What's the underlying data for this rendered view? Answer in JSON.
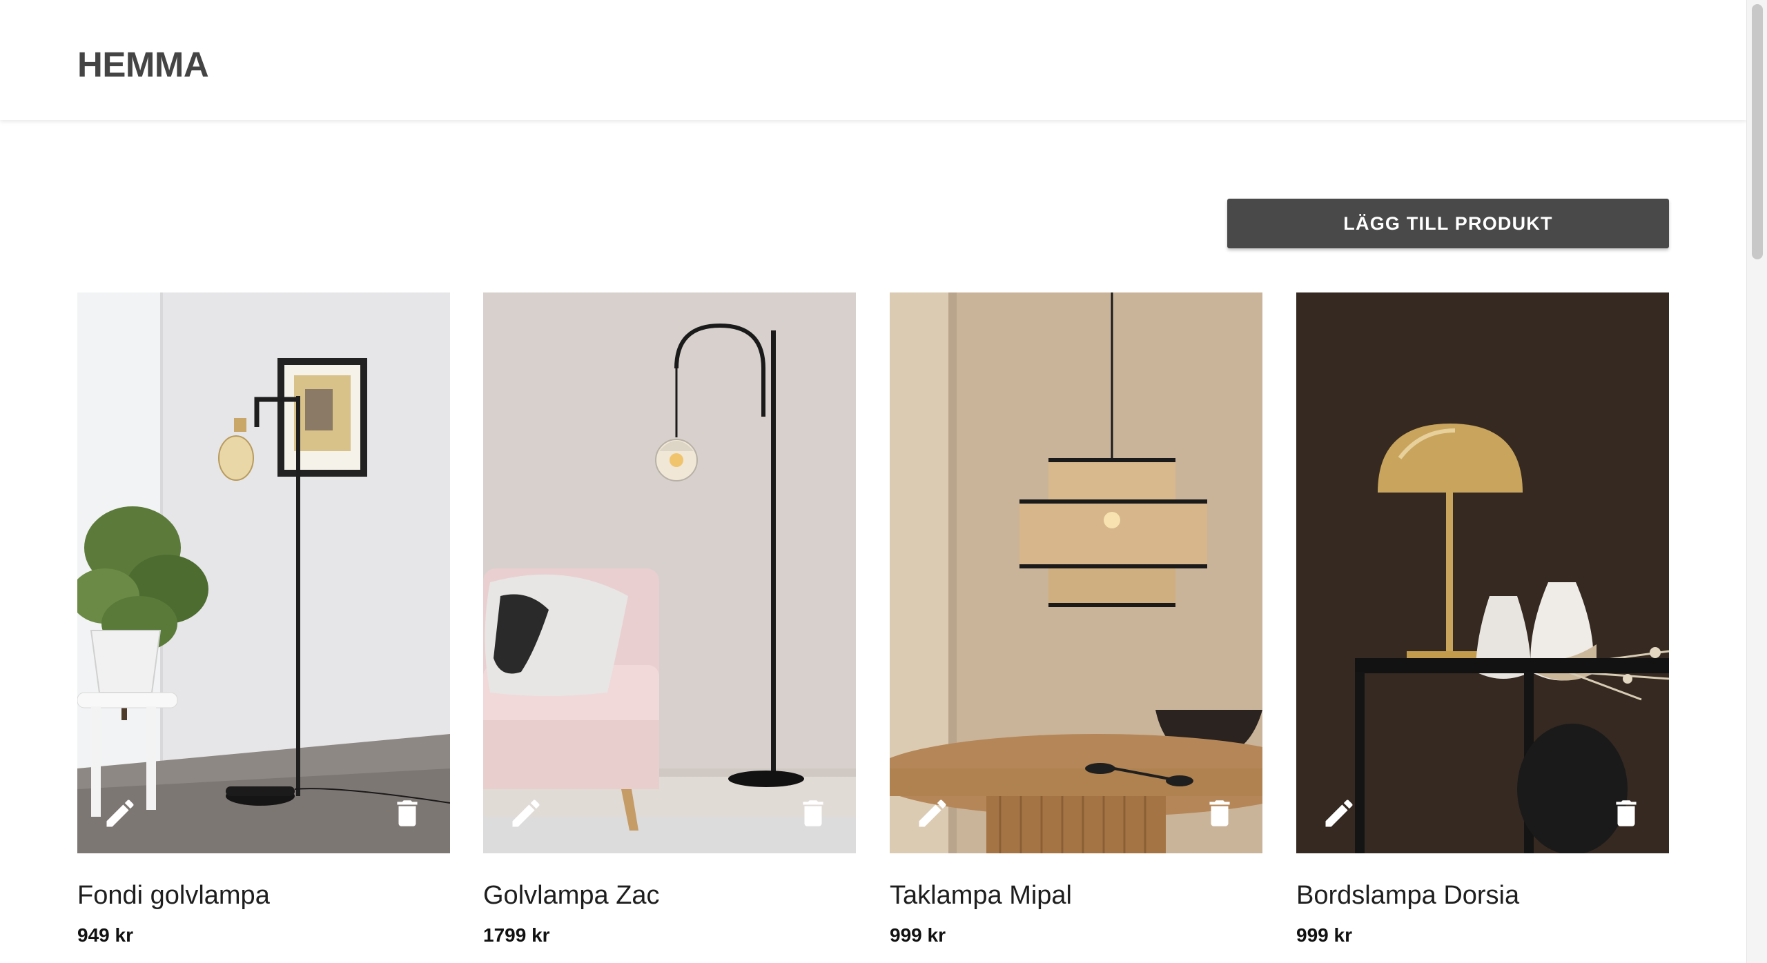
{
  "header": {
    "brand": "HEMMA"
  },
  "actions": {
    "add_product_label": "LÄGG TILL PRODUKT"
  },
  "products": [
    {
      "name": "Fondi golvlampa",
      "price": "949 kr"
    },
    {
      "name": "Golvlampa Zac",
      "price": "1799 kr"
    },
    {
      "name": "Taklampa Mipal",
      "price": "999 kr"
    },
    {
      "name": "Bordslampa Dorsia",
      "price": "999 kr"
    }
  ],
  "icons": {
    "edit": "pencil-icon",
    "delete": "trash-icon"
  },
  "colors": {
    "header_text": "#444444",
    "button_bg": "#494949",
    "button_text": "#ffffff"
  }
}
